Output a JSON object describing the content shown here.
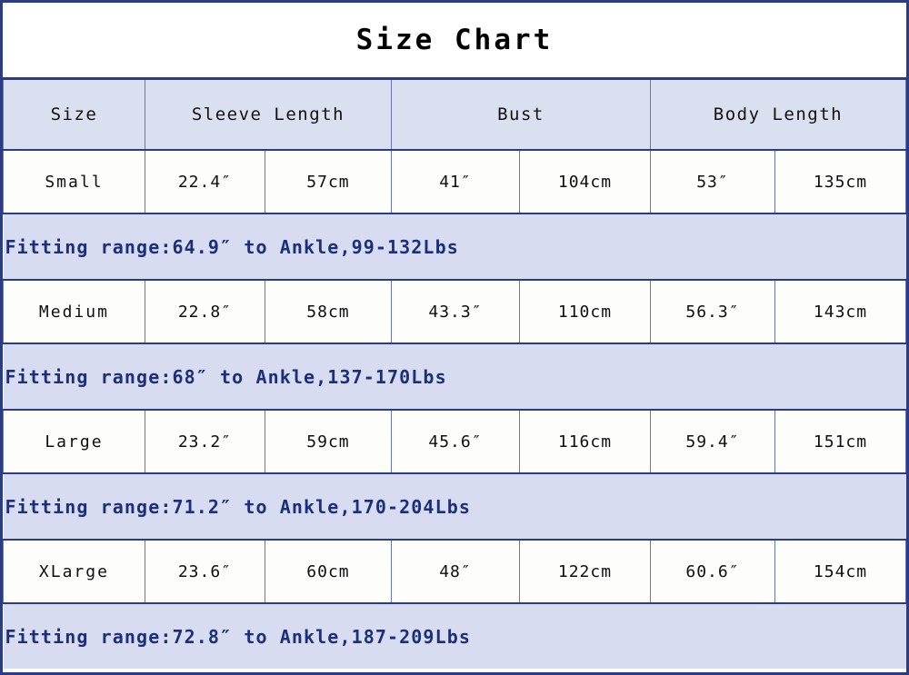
{
  "title": "Size Chart",
  "columns": [
    {
      "label": "Size",
      "span": 1
    },
    {
      "label": "Sleeve Length",
      "span": 2
    },
    {
      "label": "Bust",
      "span": 2
    },
    {
      "label": "Body Length",
      "span": 2
    }
  ],
  "rows": [
    {
      "size": "Small",
      "sleeve_in": "22.4″",
      "sleeve_cm": "57cm",
      "bust_in": "41″",
      "bust_cm": "104cm",
      "body_in": "53″",
      "body_cm": "135cm",
      "fitting": "Fitting range:64.9″ to Ankle,99-132Lbs"
    },
    {
      "size": "Medium",
      "sleeve_in": "22.8″",
      "sleeve_cm": "58cm",
      "bust_in": "43.3″",
      "bust_cm": "110cm",
      "body_in": "56.3″",
      "body_cm": "143cm",
      "fitting": "Fitting range:68″ to Ankle,137-170Lbs"
    },
    {
      "size": "Large",
      "sleeve_in": "23.2″",
      "sleeve_cm": "59cm",
      "bust_in": "45.6″",
      "bust_cm": "116cm",
      "body_in": "59.4″",
      "body_cm": "151cm",
      "fitting": "Fitting range:71.2″ to Ankle,170-204Lbs"
    },
    {
      "size": "XLarge",
      "sleeve_in": "23.6″",
      "sleeve_cm": "60cm",
      "bust_in": "48″",
      "bust_cm": "122cm",
      "body_in": "60.6″",
      "body_cm": "154cm",
      "fitting": "Fitting range:72.8″ to Ankle,187-209Lbs"
    }
  ],
  "colors": {
    "border": "#2a3c86",
    "grid": "#6577b8",
    "header_bg": "#dbe0f0",
    "fitting_bg": "#d7dcf1",
    "fitting_text": "#1c2f7a",
    "data_bg": "#fdfdfc",
    "title_text": "#000000"
  }
}
